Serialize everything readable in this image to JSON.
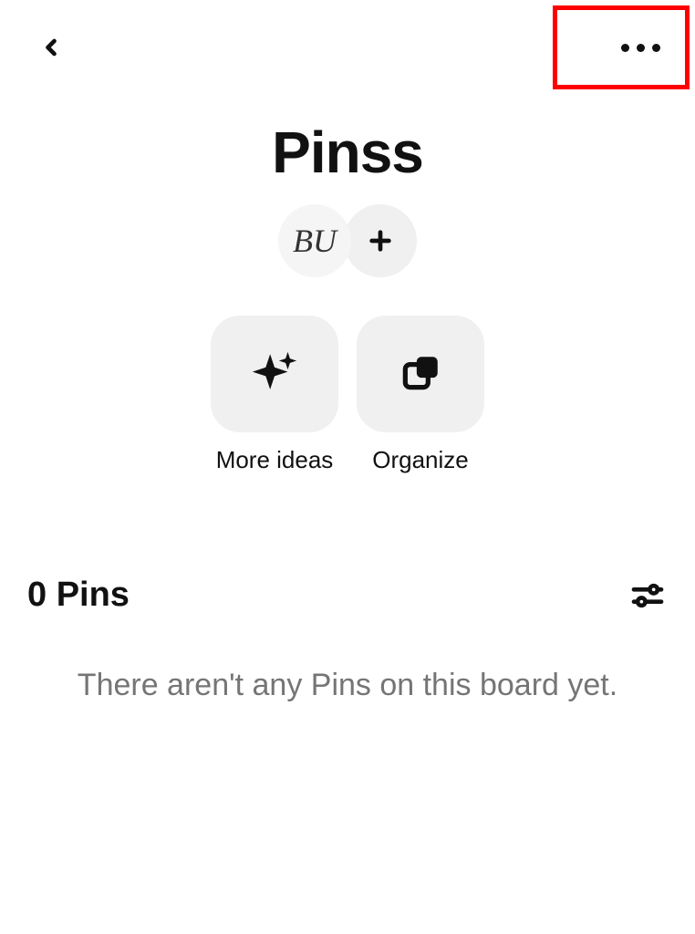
{
  "header": {
    "board_title": "Pinss",
    "avatar_initials": "BU"
  },
  "actions": {
    "more_ideas_label": "More ideas",
    "organize_label": "Organize"
  },
  "pins": {
    "count_label": "0 Pins",
    "empty_message": "There aren't any Pins on this board yet."
  }
}
